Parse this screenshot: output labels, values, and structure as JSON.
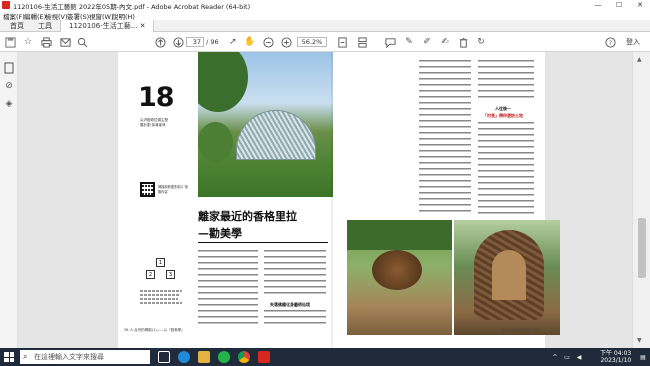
{
  "window": {
    "title": "1120106-生活工藝館 2022年05期-內文.pdf - Adobe Acrobat Reader (64-bit)",
    "controls": [
      "—",
      "☐",
      "✕"
    ]
  },
  "menu": [
    "檔案(F)",
    "編輯(E)",
    "檢視(V)",
    "簽署(S)",
    "視窗(W)",
    "說明(H)"
  ],
  "tabs": [
    {
      "label": "首頁"
    },
    {
      "label": "工具"
    },
    {
      "label": "1120106-生活工藝...  ✕"
    }
  ],
  "toolbar": {
    "page_current": "37",
    "page_total": "/ 96",
    "zoom": "56.2%",
    "signin": "登入"
  },
  "document": {
    "big_number": "18",
    "tagline": "尖沢樹奇拉頓主發展計劃 探尋雀林",
    "qr_note": "掃描觀看更多影片 相關內容",
    "heading_line1": "離家最近的香格里拉",
    "heading_line2": "—勸美學",
    "boxes": [
      "1",
      "2",
      "3"
    ],
    "subhead_left": "失落佛國化身藝術仙境",
    "subhead_right_1": "人往後一",
    "subhead_right_2": "「村長」帶你遊訪土地",
    "footer_left": "38 人 台灣的鄉鎮(1)——以『勸美學』",
    "footer_right": "N  COVER STORY  37"
  },
  "taskbar": {
    "search_placeholder": "在這裡輸入文字來搜尋",
    "time": "下午 04:03",
    "date": "2023/1/10",
    "icons": [
      "task-view",
      "edge",
      "file-explorer",
      "line",
      "chrome",
      "acrobat"
    ]
  }
}
